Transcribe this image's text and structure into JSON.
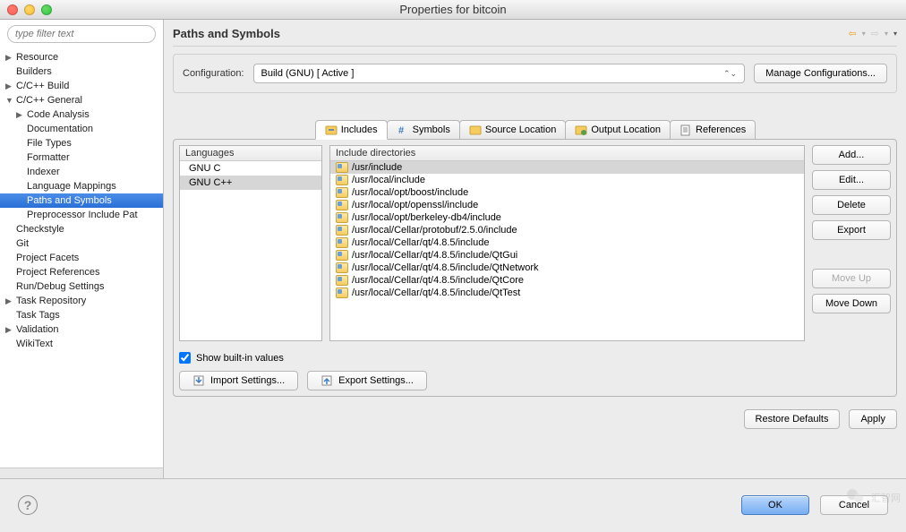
{
  "window": {
    "title": "Properties for bitcoin"
  },
  "filter": {
    "placeholder": "type filter text"
  },
  "tree": [
    {
      "label": "Resource",
      "arrow": "▶",
      "indent": 0
    },
    {
      "label": "Builders",
      "arrow": "",
      "indent": 0
    },
    {
      "label": "C/C++ Build",
      "arrow": "▶",
      "indent": 0
    },
    {
      "label": "C/C++ General",
      "arrow": "▼",
      "indent": 0
    },
    {
      "label": "Code Analysis",
      "arrow": "▶",
      "indent": 1
    },
    {
      "label": "Documentation",
      "arrow": "",
      "indent": 1
    },
    {
      "label": "File Types",
      "arrow": "",
      "indent": 1
    },
    {
      "label": "Formatter",
      "arrow": "",
      "indent": 1
    },
    {
      "label": "Indexer",
      "arrow": "",
      "indent": 1
    },
    {
      "label": "Language Mappings",
      "arrow": "",
      "indent": 1
    },
    {
      "label": "Paths and Symbols",
      "arrow": "",
      "indent": 1,
      "selected": true
    },
    {
      "label": "Preprocessor Include Pat",
      "arrow": "",
      "indent": 1
    },
    {
      "label": "Checkstyle",
      "arrow": "",
      "indent": 0
    },
    {
      "label": "Git",
      "arrow": "",
      "indent": 0
    },
    {
      "label": "Project Facets",
      "arrow": "",
      "indent": 0
    },
    {
      "label": "Project References",
      "arrow": "",
      "indent": 0
    },
    {
      "label": "Run/Debug Settings",
      "arrow": "",
      "indent": 0
    },
    {
      "label": "Task Repository",
      "arrow": "▶",
      "indent": 0
    },
    {
      "label": "Task Tags",
      "arrow": "",
      "indent": 0
    },
    {
      "label": "Validation",
      "arrow": "▶",
      "indent": 0
    },
    {
      "label": "WikiText",
      "arrow": "",
      "indent": 0
    }
  ],
  "page": {
    "title": "Paths and Symbols",
    "configLabel": "Configuration:",
    "configValue": "Build (GNU)  [ Active ]",
    "manageBtn": "Manage Configurations..."
  },
  "tabs": [
    {
      "label": "Includes",
      "active": true
    },
    {
      "label": "Symbols"
    },
    {
      "label": "Source Location"
    },
    {
      "label": "Output Location"
    },
    {
      "label": "References"
    }
  ],
  "langs": {
    "header": "Languages",
    "items": [
      {
        "label": "GNU C"
      },
      {
        "label": "GNU C++",
        "selected": true
      }
    ]
  },
  "dirs": {
    "header": "Include directories",
    "items": [
      {
        "path": "/usr/include",
        "selected": true
      },
      {
        "path": "/usr/local/include"
      },
      {
        "path": "/usr/local/opt/boost/include"
      },
      {
        "path": "/usr/local/opt/openssl/include"
      },
      {
        "path": "/usr/local/opt/berkeley-db4/include"
      },
      {
        "path": "/usr/local/Cellar/protobuf/2.5.0/include"
      },
      {
        "path": "/usr/local/Cellar/qt/4.8.5/include"
      },
      {
        "path": "/usr/local/Cellar/qt/4.8.5/include/QtGui"
      },
      {
        "path": "/usr/local/Cellar/qt/4.8.5/include/QtNetwork"
      },
      {
        "path": "/usr/local/Cellar/qt/4.8.5/include/QtCore"
      },
      {
        "path": "/usr/local/Cellar/qt/4.8.5/include/QtTest"
      }
    ]
  },
  "sideButtons": {
    "add": "Add...",
    "edit": "Edit...",
    "delete": "Delete",
    "export": "Export",
    "moveUp": "Move Up",
    "moveDown": "Move Down"
  },
  "checkbox": {
    "label": "Show built-in values",
    "checked": true
  },
  "importBtn": "Import Settings...",
  "exportBtn": "Export Settings...",
  "restoreBtn": "Restore Defaults",
  "applyBtn": "Apply",
  "footer": {
    "ok": "OK",
    "cancel": "Cancel"
  },
  "watermark": "汇智网"
}
